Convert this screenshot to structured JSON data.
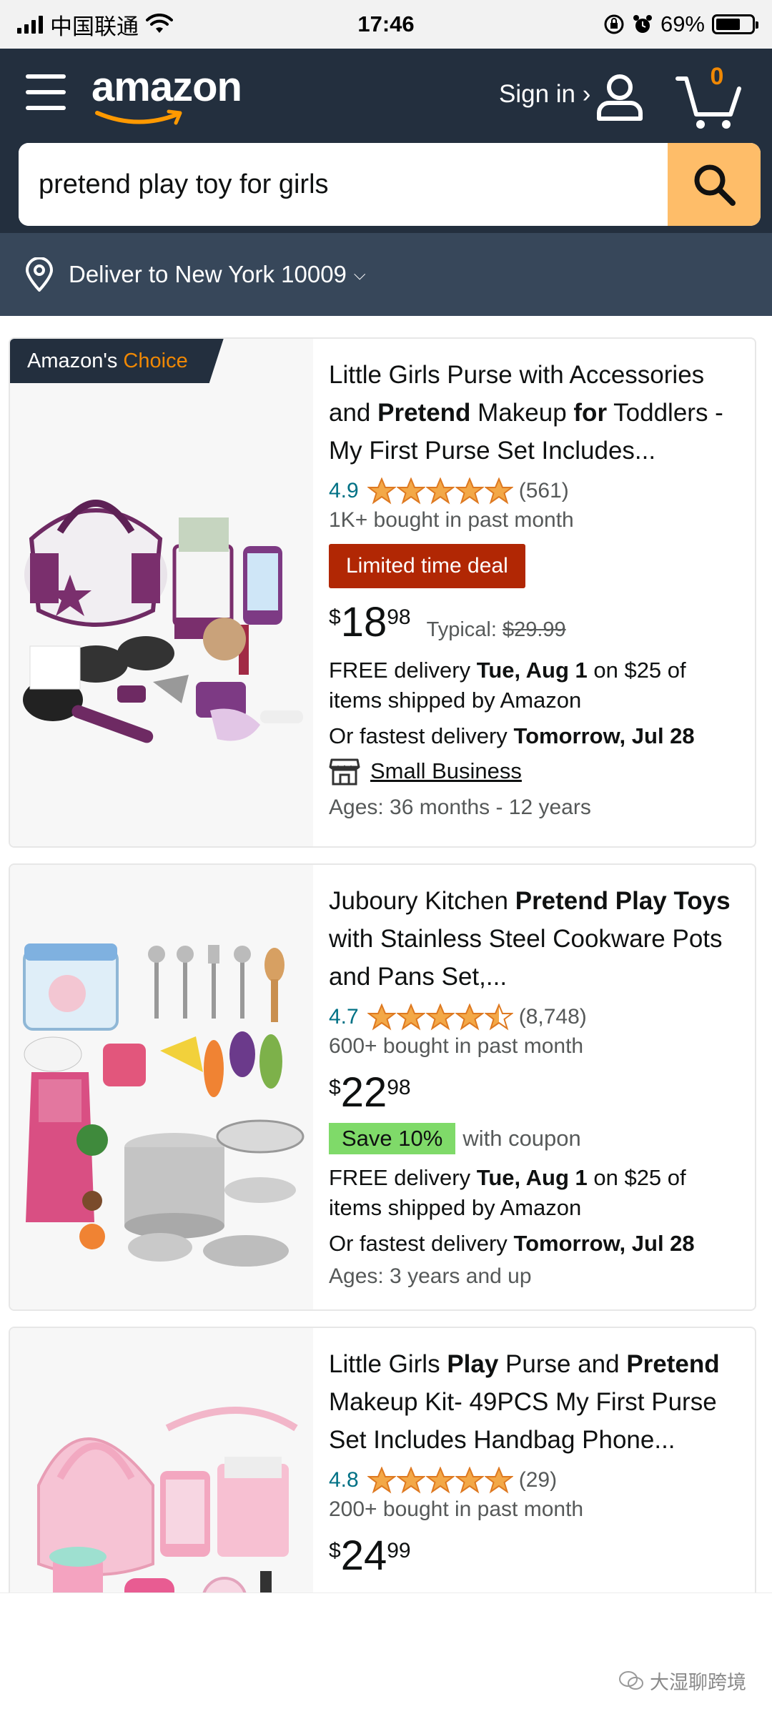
{
  "status_bar": {
    "carrier": "中国联通",
    "time": "17:46",
    "battery": "69%",
    "battery_level": 0.69
  },
  "header": {
    "logo_text": "amazon",
    "sign_in": "Sign in ›",
    "cart_count": "0"
  },
  "search": {
    "value": "pretend play toy for girls"
  },
  "delivery": {
    "label": "Deliver to New York 10009"
  },
  "colors": {
    "header_bg": "#232f3e",
    "deliver_bg": "#37475a",
    "search_button": "#febd69",
    "deal_red": "#b12704",
    "coupon_green": "#7fda69",
    "star": "#f3a847",
    "link_teal": "#007185"
  },
  "products": [
    {
      "badge_prefix": "Amazon's",
      "badge_choice": "Choice",
      "title_parts": [
        {
          "t": "Little Girls Purse with Accessories and ",
          "b": false
        },
        {
          "t": "Pretend",
          "b": true
        },
        {
          "t": " Makeup ",
          "b": false
        },
        {
          "t": "for",
          "b": true
        },
        {
          "t": " Toddlers - My First Purse Set Includes...",
          "b": false
        }
      ],
      "rating": "4.9",
      "stars": 5,
      "reviews": "(561)",
      "bought": "1K+ bought in past month",
      "deal": "Limited time deal",
      "price_symbol": "$",
      "price_whole": "18",
      "price_fraction": "98",
      "typical_label": "Typical:",
      "typical_price": "$29.99",
      "delivery_prefix": "FREE delivery",
      "delivery_date": "Tue, Aug 1",
      "delivery_suffix": "on $25 of items shipped by Amazon",
      "fastest_prefix": "Or fastest delivery",
      "fastest_date": "Tomorrow, Jul 28",
      "small_business": "Small Business",
      "ages": "Ages: 36 months - 12 years"
    },
    {
      "title_parts": [
        {
          "t": "Juboury Kitchen ",
          "b": false
        },
        {
          "t": "Pretend Play Toys",
          "b": true
        },
        {
          "t": " with Stainless Steel Cookware Pots and Pans Set,...",
          "b": false
        }
      ],
      "rating": "4.7",
      "stars": 4.5,
      "reviews": "(8,748)",
      "bought": "600+ bought in past month",
      "price_symbol": "$",
      "price_whole": "22",
      "price_fraction": "98",
      "coupon": "Save 10%",
      "coupon_text": "with coupon",
      "delivery_prefix": "FREE delivery",
      "delivery_date": "Tue, Aug 1",
      "delivery_suffix": "on $25 of items shipped by Amazon",
      "fastest_prefix": "Or fastest delivery",
      "fastest_date": "Tomorrow, Jul 28",
      "ages": "Ages: 3 years and up"
    },
    {
      "title_parts": [
        {
          "t": "Little Girls ",
          "b": false
        },
        {
          "t": "Play",
          "b": true
        },
        {
          "t": " Purse and ",
          "b": false
        },
        {
          "t": "Pretend",
          "b": true
        },
        {
          "t": " Makeup Kit- 49PCS My First Purse Set Includes Handbag Phone...",
          "b": false
        }
      ],
      "rating": "4.8",
      "stars": 5,
      "reviews": "(29)",
      "bought": "200+ bought in past month",
      "price_symbol": "$",
      "price_whole": "24",
      "price_fraction": "99"
    }
  ],
  "watermark": "大湿聊跨境"
}
